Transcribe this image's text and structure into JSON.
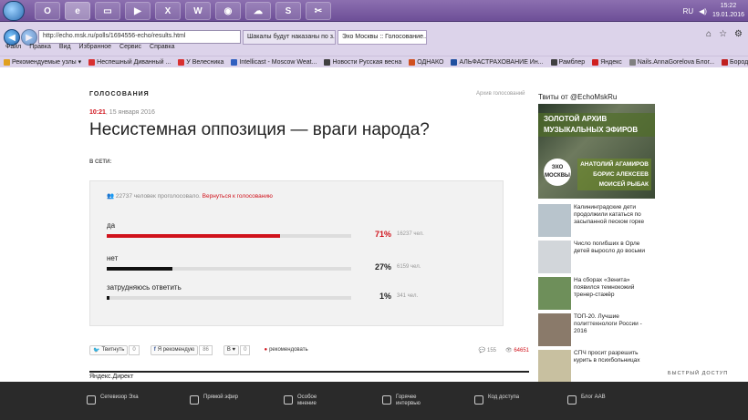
{
  "taskbar": {
    "apps": [
      {
        "icon": "O",
        "name": "outlook-icon"
      },
      {
        "icon": "e",
        "name": "internet-explorer-icon"
      },
      {
        "icon": "▭",
        "name": "explorer-icon"
      },
      {
        "icon": "▶",
        "name": "media-player-icon"
      },
      {
        "icon": "X",
        "name": "excel-icon"
      },
      {
        "icon": "W",
        "name": "word-icon"
      },
      {
        "icon": "◉",
        "name": "chrome-icon"
      },
      {
        "icon": "☁",
        "name": "cloud-icon"
      },
      {
        "icon": "S",
        "name": "skype-icon"
      },
      {
        "icon": "✂",
        "name": "snipping-icon"
      }
    ],
    "lang": "RU",
    "time": "15:22",
    "date": "19.01.2016"
  },
  "browser": {
    "address": "http://echo.msk.ru/polls/1694556-echo/results.html",
    "tabs": [
      {
        "label": "Шакалы будут наказаны по з..."
      },
      {
        "label": "Эхо Москвы :: Голосование..."
      }
    ],
    "menu": [
      "Файл",
      "Правка",
      "Вид",
      "Избранное",
      "Сервис",
      "Справка"
    ],
    "favorites": [
      "Рекомендуемые узлы ▾",
      "Неспешный Диванный ...",
      "У Велесника",
      "Intellicast - Moscow Weat...",
      "Новости Русская весна",
      "ОДНАКО",
      "АЛЬФАСТРАХОВАНИЕ Ин...",
      "Рамблер",
      "Яндекс",
      "Nails.AnnaGorelova Блог...",
      "Бородай «Стрелков по ф..."
    ]
  },
  "page": {
    "section": "ГОЛОСОВАНИЯ",
    "archive": "Архив голосований",
    "time": "10:21",
    "date": ", 15 января 2016",
    "title": "Несистемная оппозиция — враги народа?",
    "vseti": "В СЕТИ:",
    "poll": {
      "voted": "22737 человек проголосовало.",
      "back": "Вернуться к голосованию",
      "options": [
        {
          "label": "да",
          "percent": 71,
          "percent_text": "71%",
          "count": "16237 чел.",
          "color": "#d0121b"
        },
        {
          "label": "нет",
          "percent": 27,
          "percent_text": "27%",
          "count": "6159 чел.",
          "color": "#111111"
        },
        {
          "label": "затрудняюсь ответить",
          "percent": 1,
          "percent_text": "1%",
          "count": "341 чел.",
          "color": "#111111"
        }
      ]
    },
    "share": {
      "tweet": "Твитнуть",
      "tweet_count": "0",
      "fb": "Я рекомендую",
      "fb_count": "86",
      "vk": "В ♥",
      "vk_count": "0",
      "recommend": "рекомендовать",
      "comments": "155",
      "views": "64651"
    },
    "yadirect": "Яндекс.Директ"
  },
  "sidebar": {
    "twitter_title": "Твиты от @EchoMskRu",
    "banner": {
      "line1": "ЗОЛОТОЙ АРХИВ",
      "line2": "МУЗЫКАЛЬНЫХ ЭФИРОВ",
      "logo1": "ЭХО",
      "logo2": "МОСКВЫ",
      "name1": "АНАТОЛИЙ АГАМИРОВ",
      "name2": "БОРИС АЛЕКСЕЕВ",
      "name3": "МОИСЕЙ РЫБАК"
    },
    "news": [
      {
        "text": "Калининградские дети продолжили кататься по засыпанной песком горке",
        "thumb": "#b8c4cc"
      },
      {
        "text": "Число погибших в Орле детей выросло до восьми",
        "thumb": "#d2d6da"
      },
      {
        "text": "На сборах «Зенита» появился темнокожий тренер-стажёр",
        "thumb": "#6e8f5a"
      },
      {
        "text": "ТОП-20. Лучшие политтехнологи России - 2016",
        "thumb": "#8a7a6a"
      },
      {
        "text": "СПЧ просит разрешить курить в психбольницах",
        "thumb": "#c8c0a0"
      }
    ],
    "quick": "БЫСТРЫЙ ДОСТУП"
  },
  "footer": {
    "items": [
      {
        "label": "Сетевизор Эха",
        "icon": "tv-icon"
      },
      {
        "label": "Прямой эфир",
        "icon": "microphone-icon"
      },
      {
        "label": "Особое мнение",
        "icon": "opinion-icon"
      },
      {
        "label": "Горячее интервью",
        "icon": "interview-icon"
      },
      {
        "label": "Код доступа",
        "icon": "lock-icon"
      },
      {
        "label": "Блог ААВ",
        "icon": "blog-icon"
      }
    ]
  }
}
